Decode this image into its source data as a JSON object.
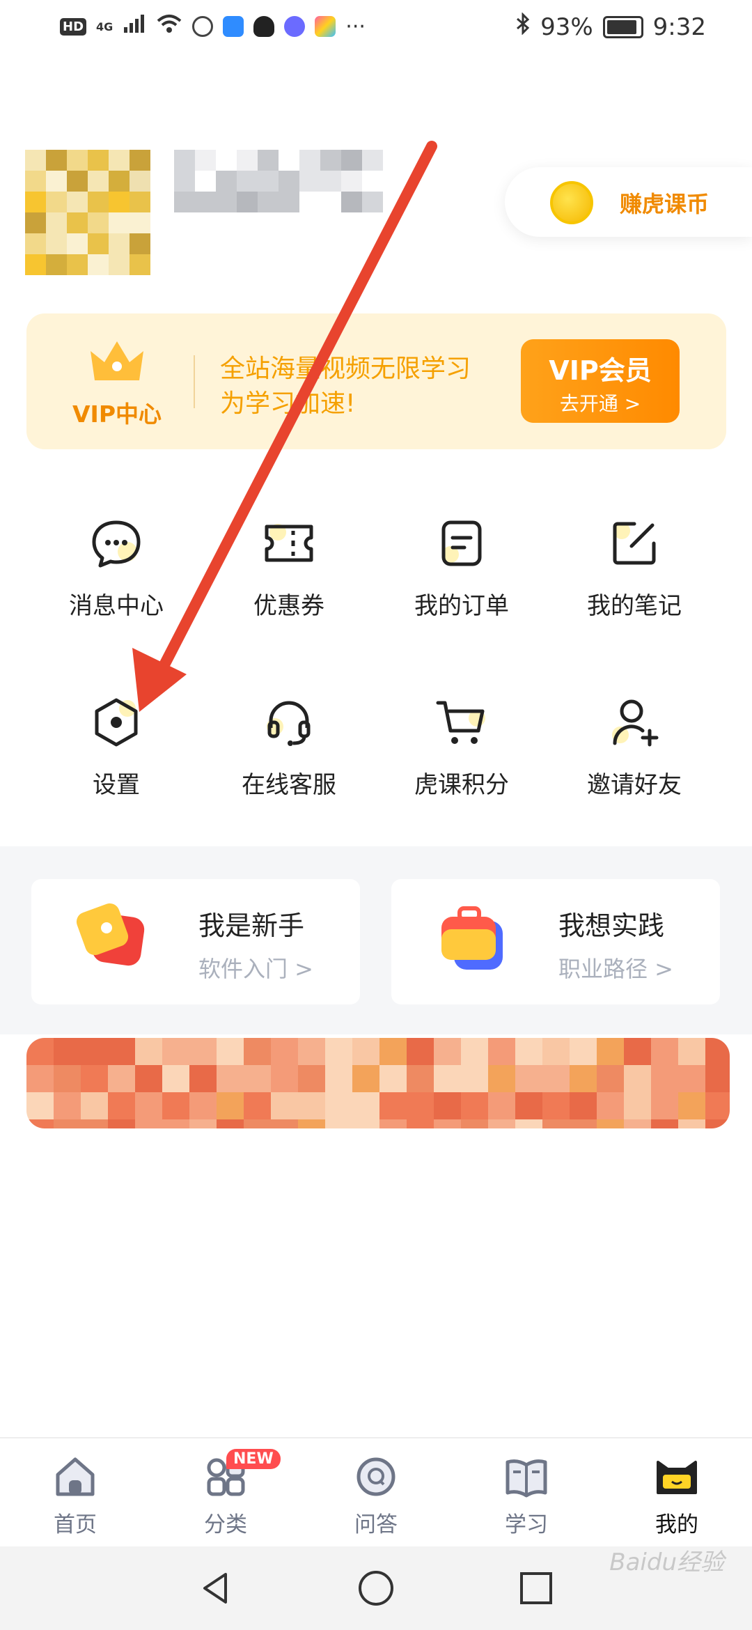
{
  "status_bar": {
    "network": "4G",
    "icons": [
      "hd-icon",
      "signal-icon",
      "wifi-icon",
      "shield-app-icon",
      "cloud-app-icon",
      "qq-icon",
      "music-app-icon",
      "palette-app-icon",
      "more-dots-icon"
    ],
    "bluetooth_icon": "bluetooth-icon",
    "battery": "93%",
    "time": "9:32"
  },
  "profile": {
    "earn_coins_label": "赚虎课币"
  },
  "vip": {
    "center_label": "VIP中心",
    "promo_line1": "全站海量视频无限学习",
    "promo_line2": "为学习加速!",
    "button_title": "VIP会员",
    "button_sub": "去开通 >"
  },
  "grid": [
    {
      "label": "消息中心",
      "icon": "message-icon"
    },
    {
      "label": "优惠券",
      "icon": "coupon-icon"
    },
    {
      "label": "我的订单",
      "icon": "order-icon"
    },
    {
      "label": "我的笔记",
      "icon": "note-edit-icon"
    },
    {
      "label": "设置",
      "icon": "settings-icon"
    },
    {
      "label": "在线客服",
      "icon": "headset-icon"
    },
    {
      "label": "虎课积分",
      "icon": "cart-icon"
    },
    {
      "label": "邀请好友",
      "icon": "add-user-icon"
    }
  ],
  "entries": [
    {
      "title": "我是新手",
      "sub": "软件入门 >"
    },
    {
      "title": "我想实践",
      "sub": "职业路径 >"
    }
  ],
  "tabs": [
    {
      "label": "首页",
      "icon": "home-icon"
    },
    {
      "label": "分类",
      "icon": "category-icon"
    },
    {
      "label": "问答",
      "icon": "qa-icon"
    },
    {
      "label": "学习",
      "icon": "book-icon"
    },
    {
      "label": "我的",
      "icon": "cat-face-icon"
    }
  ],
  "active_tab": "我的",
  "new_badge": "NEW",
  "nav": [
    "back-icon",
    "home-circle-icon",
    "recents-icon"
  ],
  "watermark": "Baidu经验",
  "colors": {
    "accent": "#f08a00",
    "vip_bg": "#fff4d8",
    "arrow": "#e8442e"
  }
}
